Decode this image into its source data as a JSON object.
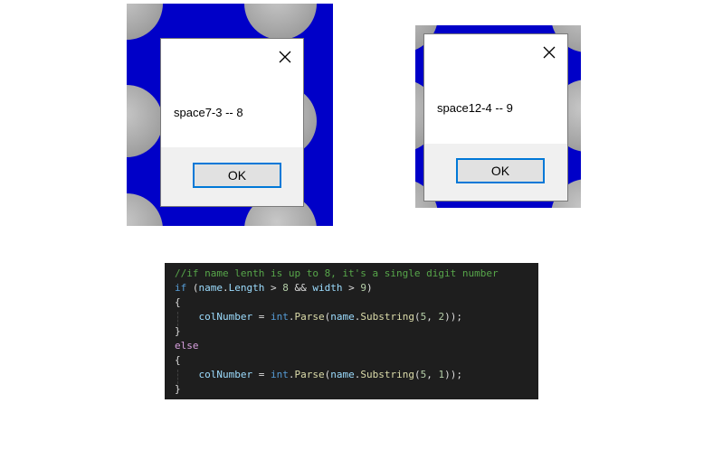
{
  "dialog1": {
    "message": "space7-3 -- 8",
    "ok_label": "OK"
  },
  "dialog2": {
    "message": "space12-4 -- 9",
    "ok_label": "OK"
  },
  "colors": {
    "background_blue": "#0000c8",
    "ok_border": "#0078d7",
    "code_bg": "#1e1e1e"
  },
  "code": {
    "lines": [
      [
        {
          "t": "//if name lenth is up to 8, it's a single digit number",
          "c": "c-comment"
        }
      ],
      [
        {
          "t": "if",
          "c": "c-kw"
        },
        {
          "t": " (",
          "c": "c-plain"
        },
        {
          "t": "name",
          "c": "c-id"
        },
        {
          "t": ".",
          "c": "c-plain"
        },
        {
          "t": "Length",
          "c": "c-id"
        },
        {
          "t": " > ",
          "c": "c-plain"
        },
        {
          "t": "8",
          "c": "c-num"
        },
        {
          "t": " && ",
          "c": "c-plain"
        },
        {
          "t": "width",
          "c": "c-id"
        },
        {
          "t": " > ",
          "c": "c-plain"
        },
        {
          "t": "9",
          "c": "c-num"
        },
        {
          "t": ")",
          "c": "c-plain"
        }
      ],
      [
        {
          "t": "{",
          "c": "c-plain"
        }
      ],
      [
        {
          "t": "    ",
          "c": "c-plain"
        },
        {
          "t": "colNumber",
          "c": "c-id"
        },
        {
          "t": " = ",
          "c": "c-plain"
        },
        {
          "t": "int",
          "c": "c-kw"
        },
        {
          "t": ".",
          "c": "c-plain"
        },
        {
          "t": "Parse",
          "c": "c-fn"
        },
        {
          "t": "(",
          "c": "c-plain"
        },
        {
          "t": "name",
          "c": "c-id"
        },
        {
          "t": ".",
          "c": "c-plain"
        },
        {
          "t": "Substring",
          "c": "c-fn"
        },
        {
          "t": "(",
          "c": "c-plain"
        },
        {
          "t": "5",
          "c": "c-num"
        },
        {
          "t": ", ",
          "c": "c-plain"
        },
        {
          "t": "2",
          "c": "c-num"
        },
        {
          "t": "));",
          "c": "c-plain"
        }
      ],
      [
        {
          "t": "}",
          "c": "c-plain"
        }
      ],
      [
        {
          "t": "else",
          "c": "c-kw2"
        }
      ],
      [
        {
          "t": "{",
          "c": "c-plain"
        }
      ],
      [
        {
          "t": "    ",
          "c": "c-plain"
        },
        {
          "t": "colNumber",
          "c": "c-id"
        },
        {
          "t": " = ",
          "c": "c-plain"
        },
        {
          "t": "int",
          "c": "c-kw"
        },
        {
          "t": ".",
          "c": "c-plain"
        },
        {
          "t": "Parse",
          "c": "c-fn"
        },
        {
          "t": "(",
          "c": "c-plain"
        },
        {
          "t": "name",
          "c": "c-id"
        },
        {
          "t": ".",
          "c": "c-plain"
        },
        {
          "t": "Substring",
          "c": "c-fn"
        },
        {
          "t": "(",
          "c": "c-plain"
        },
        {
          "t": "5",
          "c": "c-num"
        },
        {
          "t": ", ",
          "c": "c-plain"
        },
        {
          "t": "1",
          "c": "c-num"
        },
        {
          "t": "));",
          "c": "c-plain"
        }
      ],
      [
        {
          "t": "}",
          "c": "c-plain"
        }
      ]
    ]
  }
}
